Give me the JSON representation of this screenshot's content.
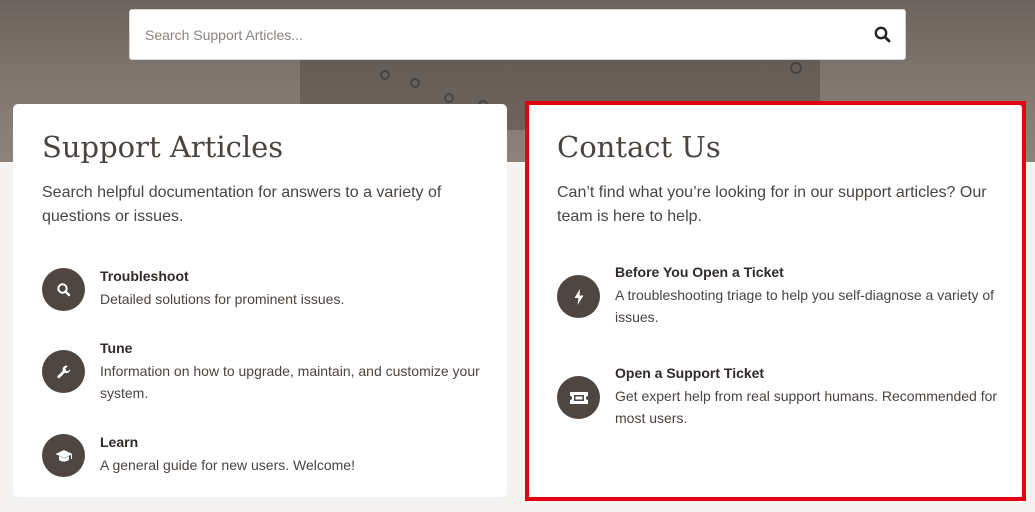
{
  "search": {
    "placeholder": "Search Support Articles..."
  },
  "support_articles": {
    "title": "Support Articles",
    "description": "Search helpful documentation for answers to a variety of questions or issues.",
    "items": [
      {
        "title": "Troubleshoot",
        "description": "Detailed solutions for prominent issues.",
        "icon": "search-icon"
      },
      {
        "title": "Tune",
        "description": "Information on how to upgrade, maintain, and customize your system.",
        "icon": "wrench-icon"
      },
      {
        "title": "Learn",
        "description": "A general guide for new users. Welcome!",
        "icon": "graduation-cap-icon"
      }
    ]
  },
  "contact_us": {
    "title": "Contact Us",
    "description": "Can’t find what you’re looking for in our support articles? Our team is here to help.",
    "items": [
      {
        "title": "Before You Open a Ticket",
        "description": "A troubleshooting triage to help you self-diagnose a variety of issues.",
        "icon": "bolt-icon"
      },
      {
        "title": "Open a Support Ticket",
        "description": "Get expert help from real support humans. Recommended for most users.",
        "icon": "ticket-icon"
      }
    ]
  },
  "colors": {
    "hero": "#7e756e",
    "icon_circle": "#4e4641",
    "highlight": "#e3000f",
    "text": "#4a4440"
  }
}
